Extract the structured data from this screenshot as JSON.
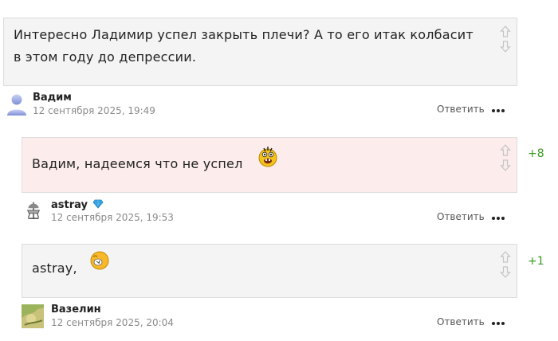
{
  "comments": [
    {
      "text_line1": "Интересно Ладимир успел закрыть плечи? А то его итак колбасит",
      "text_line2": "в этом году до депрессии.",
      "author": "Вадим",
      "date": "12 сентября 2025, 19:49",
      "reply_label": "Ответить",
      "bg_color": "#f4f4f4"
    },
    {
      "text": "Вадим, надеемся что не успел",
      "emoji": "laughing-emoji",
      "score": "+8",
      "author": "astray",
      "badge": "diamond-icon",
      "date": "12 сентября 2025, 19:53",
      "reply_label": "Ответить",
      "bg_color": "#fdecec"
    },
    {
      "text": "astray,",
      "emoji": "sad-emoji",
      "score": "+1",
      "author": "Вазелин",
      "date": "12 сентября 2025, 20:04",
      "reply_label": "Ответить",
      "bg_color": "#f4f4f4"
    }
  ],
  "colors": {
    "score": "#3a9a24",
    "border": "#dcdcdc",
    "arrow": "#c4c4c4"
  }
}
